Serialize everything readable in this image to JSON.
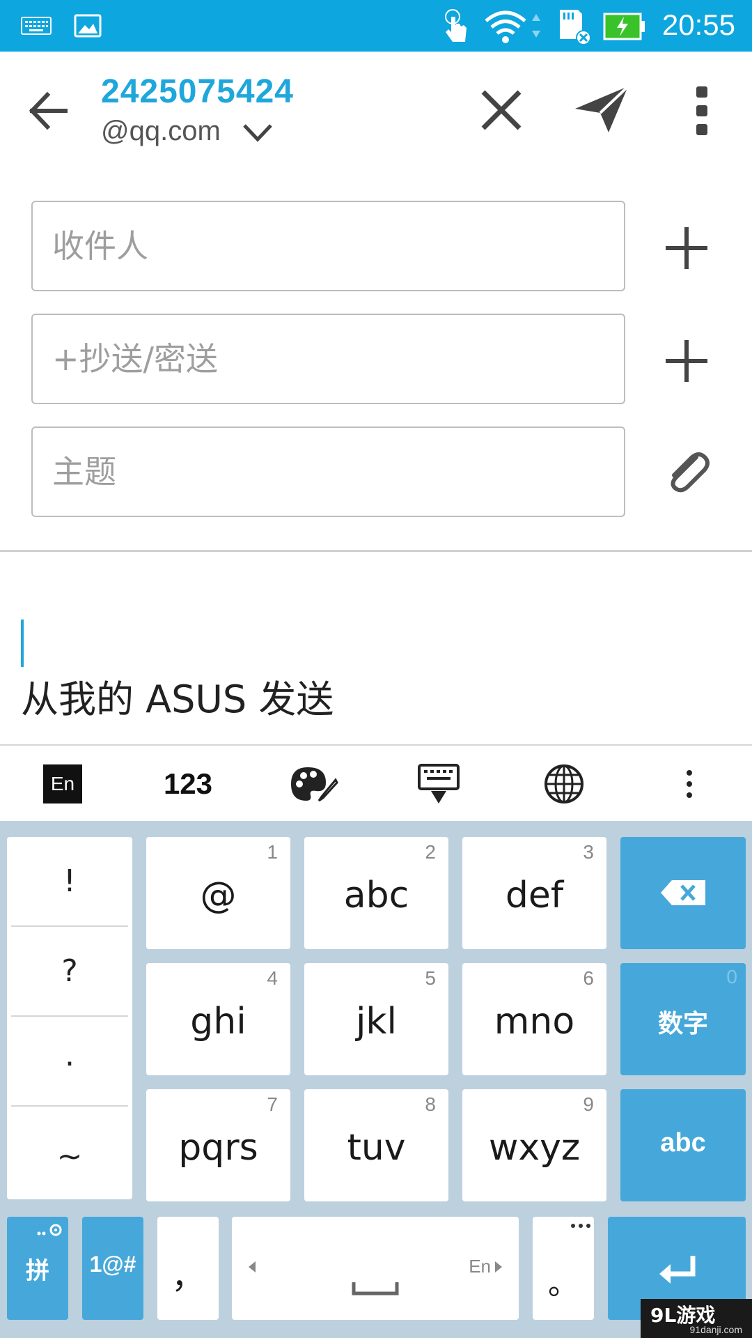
{
  "status_bar": {
    "time": "20:55",
    "bg_color": "#0da6df",
    "icons": [
      "keyboard-icon",
      "image-icon",
      "touch-icon",
      "wifi-icon",
      "sd-card-icon",
      "battery-charging-icon"
    ]
  },
  "header": {
    "account_number": "2425075424",
    "account_domain": "@qq.com",
    "accent_color": "#1fa7dc"
  },
  "form": {
    "to_placeholder": "收件人",
    "cc_placeholder": "+抄送/密送",
    "subject_placeholder": "主题"
  },
  "body": {
    "signature": "从我的 ASUS 发送"
  },
  "keyboard_toolbar": {
    "lang_badge": "En",
    "numbers_label": "123"
  },
  "keyboard": {
    "punctuation": [
      "!",
      "?",
      ".",
      "~"
    ],
    "rows": [
      [
        {
          "label": "@",
          "num": "1"
        },
        {
          "label": "abc",
          "num": "2"
        },
        {
          "label": "def",
          "num": "3"
        }
      ],
      [
        {
          "label": "ghi",
          "num": "4"
        },
        {
          "label": "jkl",
          "num": "5"
        },
        {
          "label": "mno",
          "num": "6"
        }
      ],
      [
        {
          "label": "pqrs",
          "num": "7"
        },
        {
          "label": "tuv",
          "num": "8"
        },
        {
          "label": "wxyz",
          "num": "9"
        }
      ]
    ],
    "numbers_key": {
      "label": "数字",
      "num": "0"
    },
    "abc_key": "abc",
    "pinyin_key": "拼",
    "symbols_key": "1@#",
    "comma_key": "，",
    "space_lang_hint": "En",
    "period_key": "。",
    "key_blue_color": "#46a8da",
    "bg_color": "#bdd0de"
  },
  "watermark": {
    "main": "9L游戏",
    "sub": "91danji.com"
  }
}
